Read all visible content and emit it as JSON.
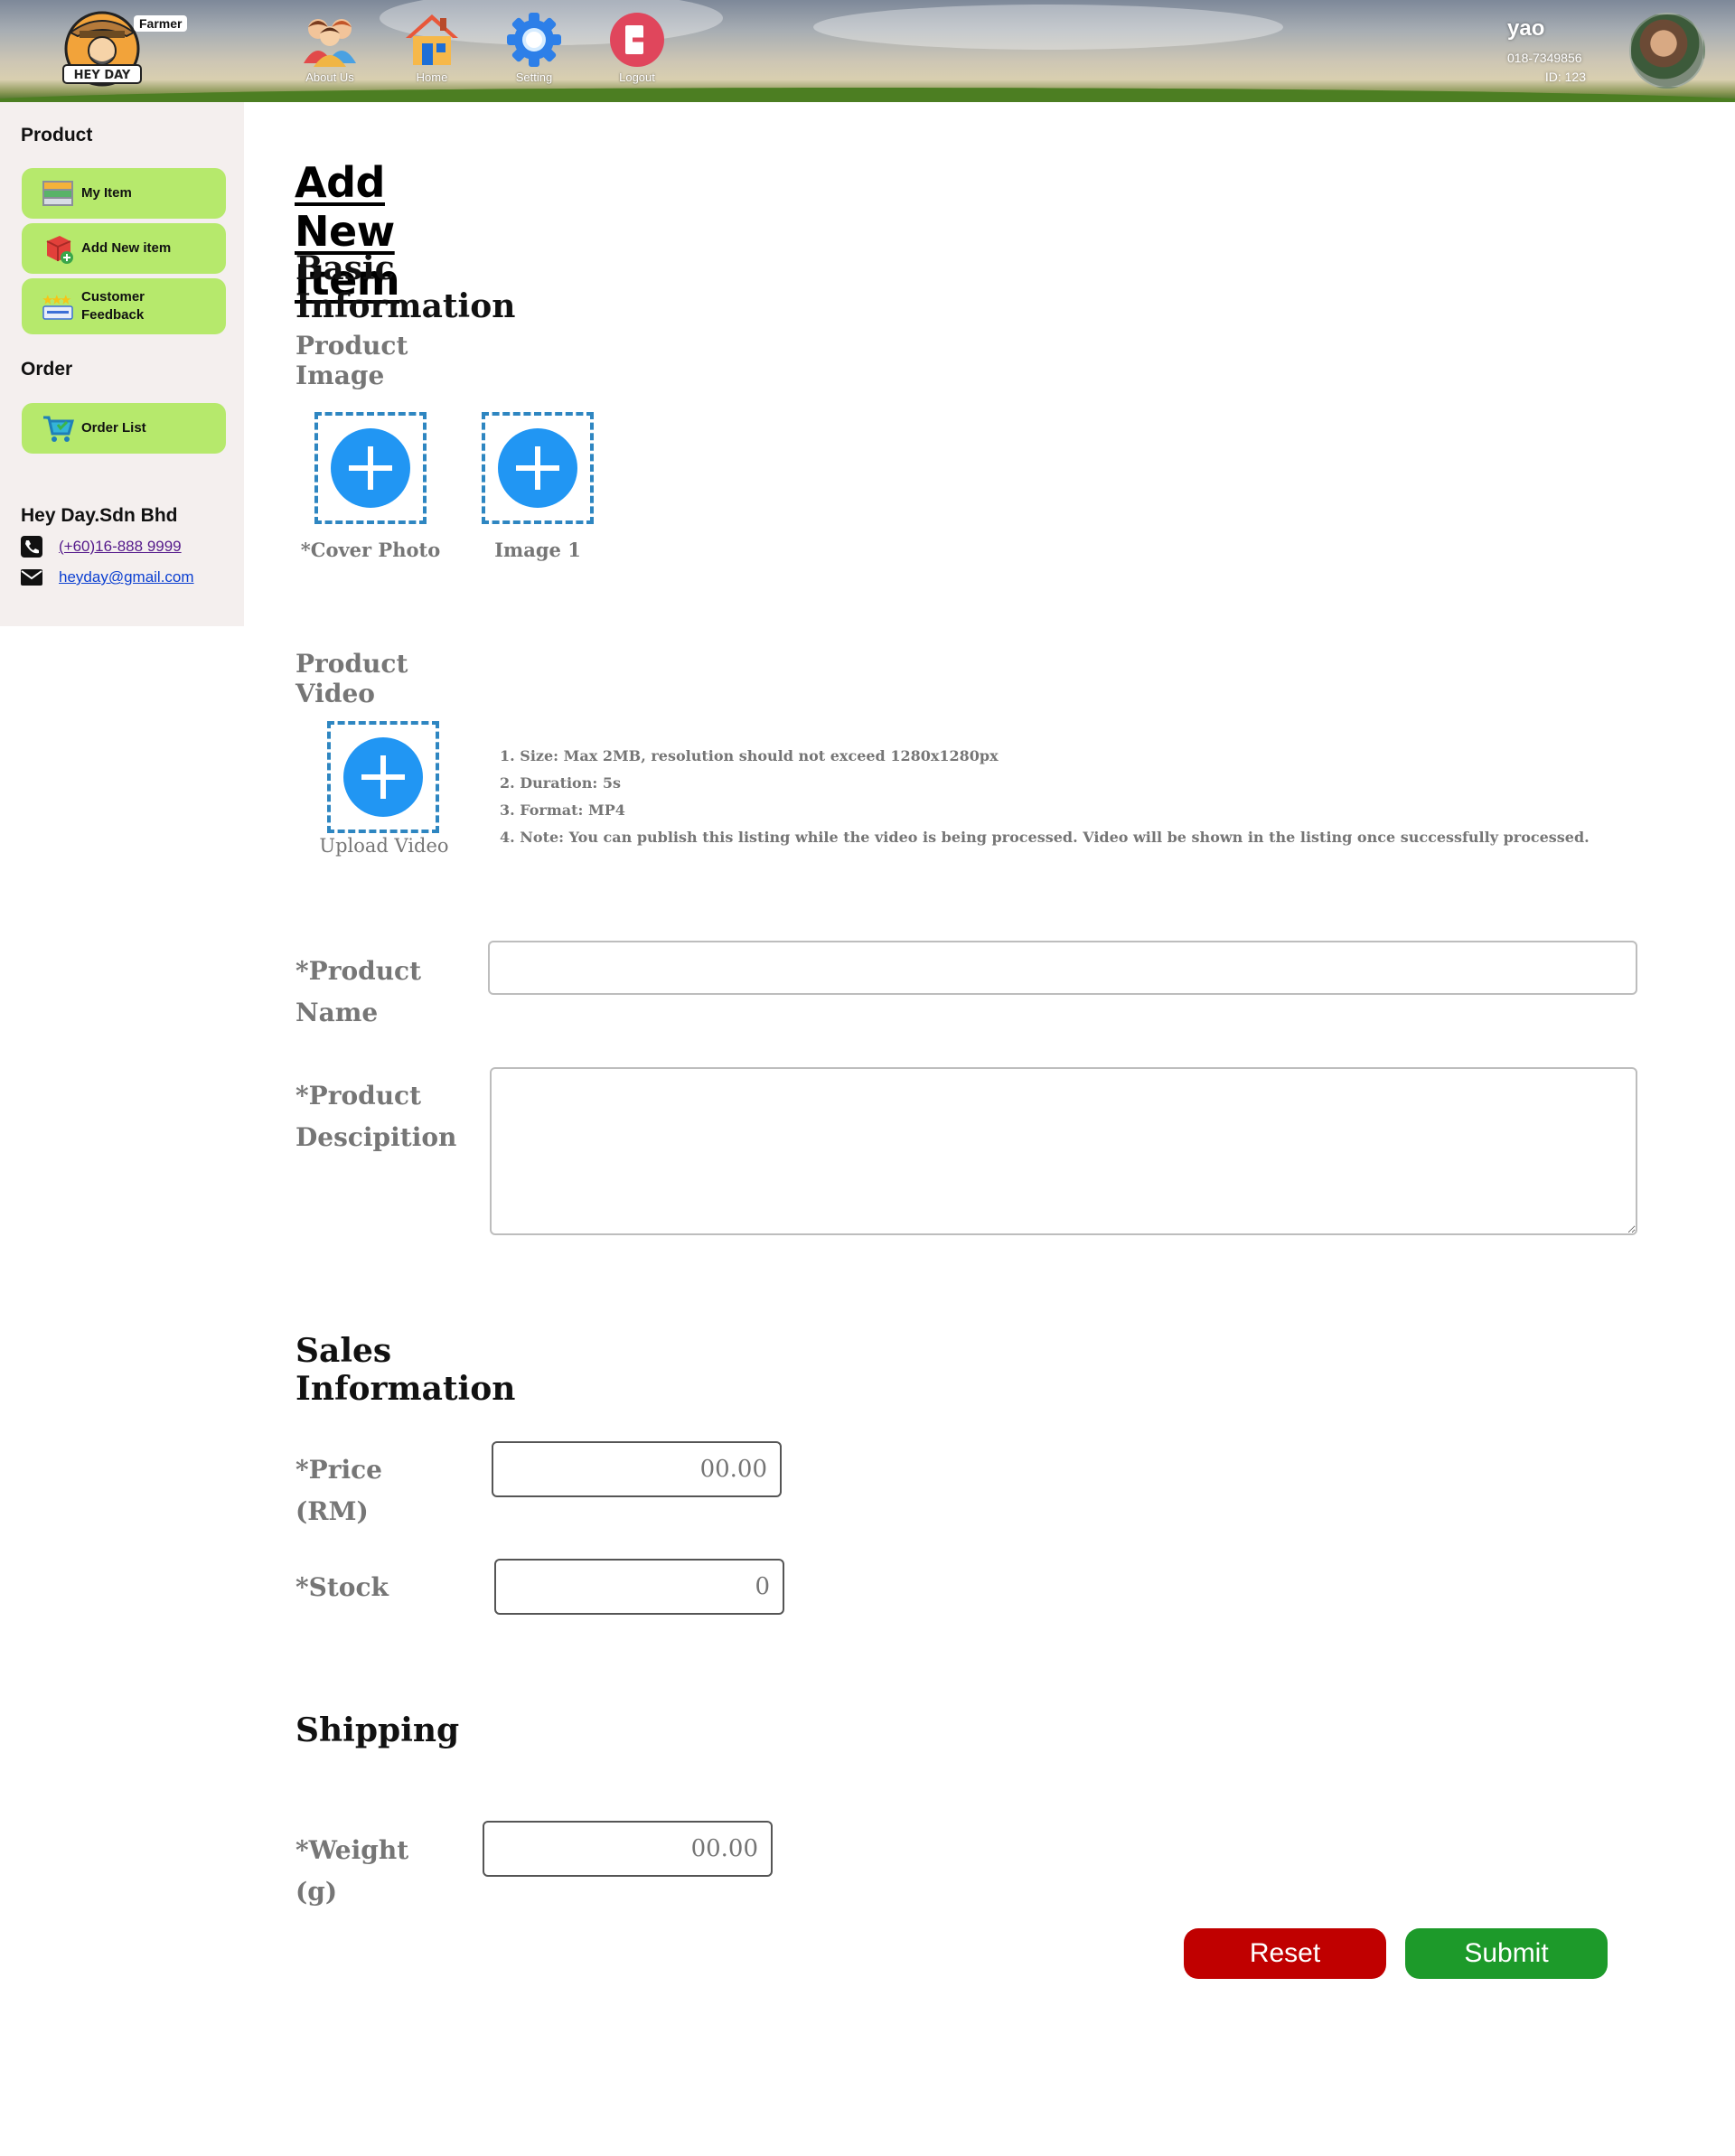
{
  "header": {
    "logo_text": "HEY DAY",
    "role_tag": "Farmer",
    "nav": [
      {
        "label": "About Us",
        "icon": "about-us-icon"
      },
      {
        "label": "Home",
        "icon": "home-icon"
      },
      {
        "label": "Setting",
        "icon": "gear-icon"
      },
      {
        "label": "Logout",
        "icon": "logout-icon"
      }
    ],
    "user": {
      "name": "yao",
      "phone": "018-7349856",
      "id": "ID: 123"
    }
  },
  "sidebar": {
    "product_heading": "Product",
    "product_items": [
      {
        "label": "My Item",
        "icon": "shelf-icon"
      },
      {
        "label": "Add New item",
        "icon": "add-box-icon"
      },
      {
        "label": "Customer Feedback",
        "icon": "rating-icon"
      }
    ],
    "order_heading": "Order",
    "order_items": [
      {
        "label": "Order List",
        "icon": "cart-icon"
      }
    ],
    "company": {
      "name": "Hey Day.Sdn Bhd",
      "phone": "(+60)16-888 9999",
      "email": "heyday@gmail.com"
    }
  },
  "main": {
    "page_title": "Add New Item",
    "basic_info_title": "Basic Information",
    "product_image_label": "Product Image",
    "image_slots": [
      {
        "caption": "*Cover Photo"
      },
      {
        "caption": "Image 1"
      }
    ],
    "product_video_label": "Product Video",
    "video_caption": "Upload Video",
    "video_notes": [
      "1. Size: Max 2MB, resolution should not exceed 1280x1280px",
      "2. Duration: 5s",
      "3. Format: MP4",
      "4. Note: You can publish this listing while the video is being processed. Video will be shown in the listing once successfully processed."
    ],
    "product_name_label": "*Product Name",
    "product_name_value": "",
    "product_desc_label_line1": "*Product",
    "product_desc_label_line2": "Descipition",
    "product_desc_value": "",
    "sales_info_title": "Sales Information",
    "price_label": "*Price (RM)",
    "price_placeholder": "00.00",
    "stock_label": "*Stock",
    "stock_placeholder": "0",
    "shipping_title": "Shipping",
    "weight_label": "*Weight (g)",
    "weight_placeholder": "00.00",
    "reset_label": "Reset",
    "submit_label": "Submit"
  },
  "colors": {
    "sidebar_bg": "#f4efee",
    "sidebar_button": "#b6e96c",
    "upload_accent": "#2196f3",
    "reset": "#c00000",
    "submit": "#1d9a2a",
    "label_gray": "#767676"
  }
}
